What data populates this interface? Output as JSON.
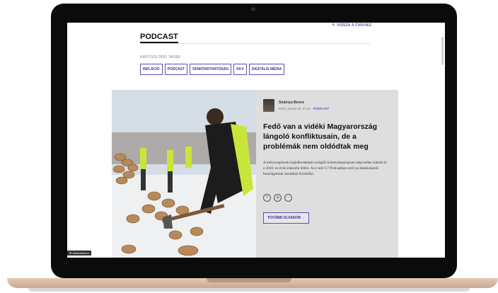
{
  "top_link": {
    "label": "VISSZA A CIKKHEZ"
  },
  "section": {
    "title": "PODCAST"
  },
  "tags": {
    "label": "KAPCSOLÓDÓ TAGEK",
    "items": [
      "INFLÁCIÓ",
      "PODCAST",
      "FENNTARTHATÓSÁG",
      "KKV",
      "DIGITÁLIS MÉDIA"
    ]
  },
  "article": {
    "author": "Stubnya Bence",
    "date": "2022. január 20. 07:22",
    "separator": "·",
    "category": "PODCAST",
    "headline": "Fedő van a vidéki Magyarország lángoló konfliktusain, de a problémák nem oldódtak meg",
    "lead": "A mélyszegények foglalkoztatását szolgáló közmunkaprogram alapvetően alakult át a 2010- es évek második felére. Az e heti G7 Podcastban erről az átalakulásról beszélgettünk Szombati Kristóffal.",
    "more_label": "TOVÁBB OLVASOM",
    "socials": [
      "f",
      "◎",
      "···"
    ]
  },
  "badge": {
    "label": "Adatvédelem"
  },
  "colors": {
    "accent": "#5b4fb5",
    "card_bg": "#dedede"
  }
}
